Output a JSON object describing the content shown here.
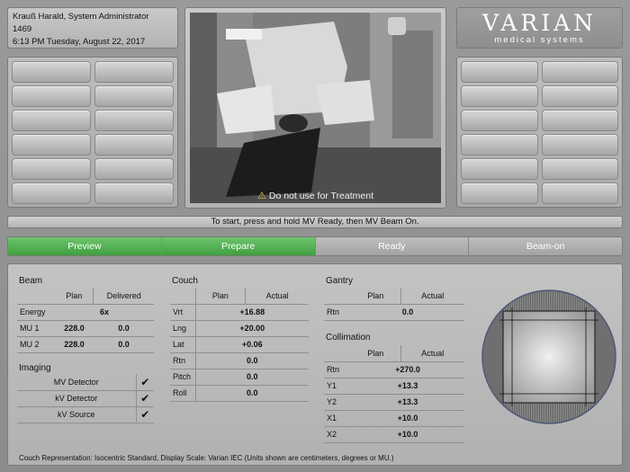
{
  "header": {
    "user": "Krauß Harald, System Administrator",
    "id": "1469",
    "datetime": "6:13 PM Tuesday, August 22, 2017"
  },
  "logo": {
    "main": "VARIAN",
    "sub": "medical systems"
  },
  "video": {
    "warning": "Do not use for Treatment",
    "warning_icon": "warning-icon"
  },
  "instruction": "To start, press and hold MV Ready, then MV Beam On.",
  "workflow": [
    {
      "label": "Preview",
      "state": "done"
    },
    {
      "label": "Prepare",
      "state": "done"
    },
    {
      "label": "Ready",
      "state": "pending"
    },
    {
      "label": "Beam-on",
      "state": "pending"
    }
  ],
  "colors": {
    "done": "#4caf50",
    "pending": "#b0b0b0"
  },
  "beam": {
    "title": "Beam",
    "headers": [
      "Plan",
      "Delivered"
    ],
    "energy_label": "Energy",
    "energy_value": "6x",
    "rows": [
      {
        "label": "MU 1",
        "plan": "228.0",
        "delivered": "0.0"
      },
      {
        "label": "MU 2",
        "plan": "228.0",
        "delivered": "0.0"
      }
    ]
  },
  "imaging": {
    "title": "Imaging",
    "rows": [
      {
        "label": "MV Detector",
        "checked": "✔"
      },
      {
        "label": "kV Detector",
        "checked": "✔"
      },
      {
        "label": "kV Source",
        "checked": "✔"
      }
    ]
  },
  "couch": {
    "title": "Couch",
    "headers": [
      "Plan",
      "Actual"
    ],
    "rows": [
      {
        "label": "Vrt",
        "value": "+16.88"
      },
      {
        "label": "Lng",
        "value": "+20.00"
      },
      {
        "label": "Lat",
        "value": "+0.06"
      },
      {
        "label": "Rtn",
        "value": "0.0"
      },
      {
        "label": "Pitch",
        "value": "0.0"
      },
      {
        "label": "Roll",
        "value": "0.0"
      }
    ]
  },
  "gantry": {
    "title": "Gantry",
    "headers": [
      "Plan",
      "Actual"
    ],
    "rows": [
      {
        "label": "Rtn",
        "value": "0.0"
      }
    ]
  },
  "collimation": {
    "title": "Collimation",
    "headers": [
      "Plan",
      "Actual"
    ],
    "rows": [
      {
        "label": "Rtn",
        "value": "+270.0"
      },
      {
        "label": "Y1",
        "value": "+13.3"
      },
      {
        "label": "Y2",
        "value": "+13.3"
      },
      {
        "label": "X1",
        "value": "+10.0"
      },
      {
        "label": "X2",
        "value": "+10.0"
      }
    ]
  },
  "footnote": "Couch Representation: Isocentric Standard, Display Scale: Varian IEC (Units shown are centimeters, degrees or MU.)"
}
